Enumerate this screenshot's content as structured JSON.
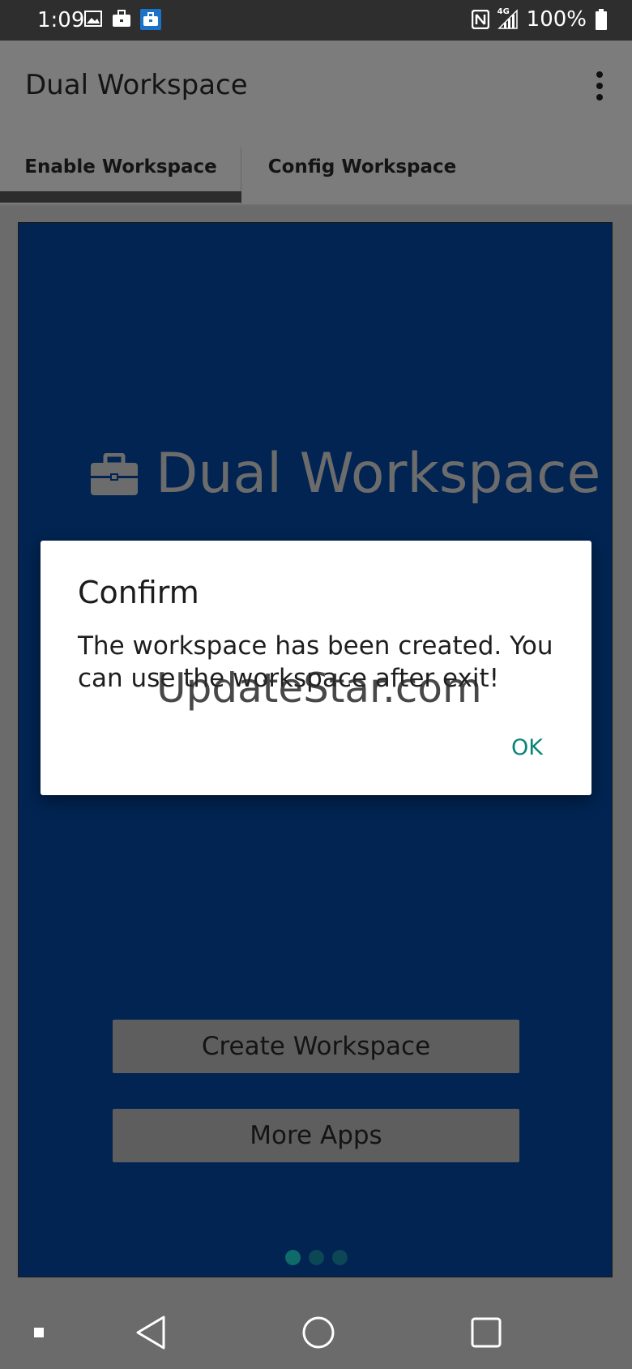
{
  "status_bar": {
    "time": "1:09",
    "network": "4G",
    "battery": "100%",
    "icons_left": [
      "image-icon",
      "briefcase-icon",
      "work-profile-icon"
    ],
    "icons_right": [
      "nfc-icon",
      "signal-icon",
      "battery-icon"
    ]
  },
  "app_bar": {
    "title": "Dual Workspace",
    "menu_icon": "overflow-menu-icon"
  },
  "tabs": [
    {
      "label": "Enable Workspace",
      "selected": true
    },
    {
      "label": "Config Workspace",
      "selected": false
    }
  ],
  "panel": {
    "brand_text": "Dual Workspace",
    "brand_icon": "briefcase-icon",
    "background": "#012452",
    "buttons": {
      "create": "Create Workspace",
      "more": "More Apps"
    },
    "pager": {
      "count": 3,
      "active": 0
    }
  },
  "dialog": {
    "title": "Confirm",
    "message": "The workspace has been created. You can use the workspace after exit!",
    "ok_label": "OK",
    "accent": "#0a8379"
  },
  "watermark": "UpdateStar.com",
  "nav_bar": {
    "icons": [
      "small-square-icon",
      "back-icon",
      "home-icon",
      "recents-icon"
    ]
  }
}
